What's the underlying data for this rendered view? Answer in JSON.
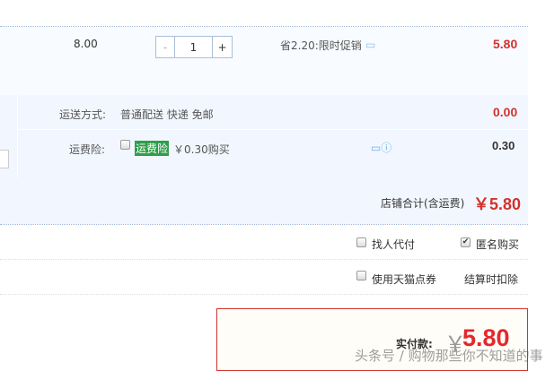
{
  "item": {
    "unit_price": "8.00",
    "quantity": "1",
    "minus": "-",
    "plus": "+",
    "promo": "省2.20:限时促销",
    "subtotal": "5.80"
  },
  "shipping": {
    "label": "运送方式:",
    "method": "普通配送 快递 免邮",
    "cost": "0.00"
  },
  "insurance": {
    "label": "运费险:",
    "badge": "运费险",
    "price": "￥0.30购买",
    "cost": "0.30"
  },
  "store_total": {
    "label": "店铺合计(含运费)",
    "amount": "￥5.80"
  },
  "options": {
    "pay_for_me": "找人代付",
    "anonymous": "匿名购买",
    "tmall_points": "使用天猫点券",
    "deduct_note": "结算时扣除"
  },
  "payment": {
    "label": "实付款:",
    "currency": "￥",
    "amount": "5.80"
  },
  "watermark": "头条号 / 购物那些你不知道的事",
  "colors": {
    "accent": "#d2322d",
    "badge": "#2e9e49"
  }
}
